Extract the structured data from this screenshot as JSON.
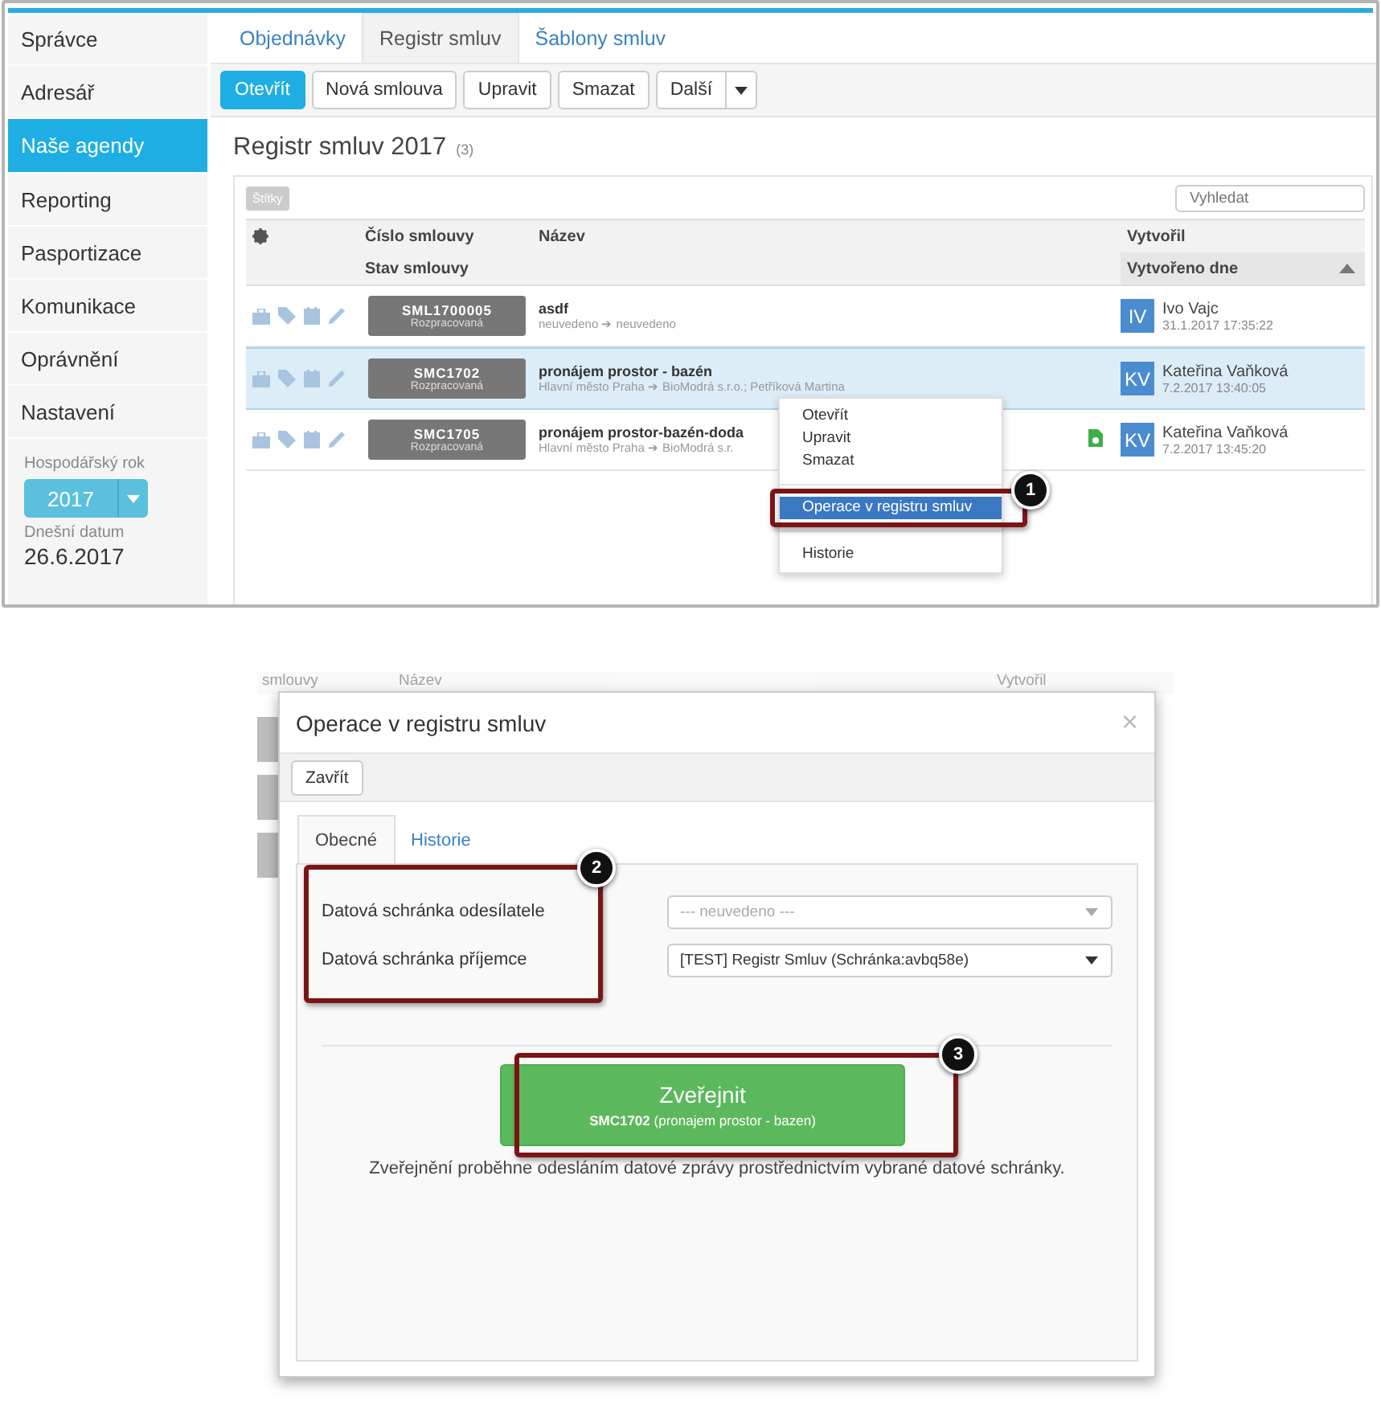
{
  "sidebar": {
    "items": [
      {
        "label": "Správce",
        "selected": false
      },
      {
        "label": "Adresář",
        "selected": false
      },
      {
        "label": "Naše agendy",
        "selected": true
      },
      {
        "label": "Reporting",
        "selected": false
      },
      {
        "label": "Pasportizace",
        "selected": false
      },
      {
        "label": "Komunikace",
        "selected": false
      },
      {
        "label": "Oprávnění",
        "selected": false
      },
      {
        "label": "Nastavení",
        "selected": false
      }
    ],
    "fiscal_year": {
      "label": "Hospodářský rok",
      "value": "2017"
    },
    "today": {
      "label": "Dnešní datum",
      "value": "26.6.2017"
    }
  },
  "tabs": [
    {
      "label": "Objednávky",
      "selected": false
    },
    {
      "label": "Registr smluv",
      "selected": true
    },
    {
      "label": "Šablony smluv",
      "selected": false
    }
  ],
  "toolbar": {
    "buttons": [
      {
        "label": "Otevřít",
        "primary": true
      },
      {
        "label": "Nová smlouva",
        "primary": false
      },
      {
        "label": "Upravit",
        "primary": false
      },
      {
        "label": "Smazat",
        "primary": false
      },
      {
        "label": "Další",
        "primary": false
      }
    ]
  },
  "heading": {
    "title": "Registr smluv 2017",
    "count": "(3)"
  },
  "table": {
    "tags_label": "Štítky",
    "search": {
      "placeholder": "Vyhledat"
    },
    "columns": {
      "number": "Číslo smlouvy",
      "status": "Stav smlouvy",
      "name": "Název",
      "author": "Vytvořil",
      "created": "Vytvořeno dne"
    },
    "rows": [
      {
        "number": "SML1700005",
        "status": "Rozpracovaná",
        "name": "asdf",
        "parties": "neuvedeno ➔ neuvedeno",
        "initials": "IV",
        "author": "Ivo Vajc",
        "created": "31.1.2017 17:35:22",
        "selected": false,
        "attachment": false
      },
      {
        "number": "SMC1702",
        "status": "Rozpracovaná",
        "name": "pronájem prostor - bazén",
        "parties": "Hlavní město Praha ➔ BioModrá s.r.o.; Petříková Martina",
        "initials": "KV",
        "author": "Kateřina Vaňková",
        "created": "7.2.2017 13:40:05",
        "selected": true,
        "attachment": false
      },
      {
        "number": "SMC1705",
        "status": "Rozpracovaná",
        "name": "pronájem prostor-bazén-doda",
        "parties": "Hlavní město Praha ➔ BioModrá s.r.",
        "initials": "KV",
        "author": "Kateřina Vaňková",
        "created": "7.2.2017 13:45:20",
        "selected": false,
        "attachment": true
      }
    ]
  },
  "context_menu": {
    "items": [
      {
        "kind": "item",
        "label": "Otevřít",
        "selected": false
      },
      {
        "kind": "item",
        "label": "Upravit",
        "selected": false
      },
      {
        "kind": "item",
        "label": "Smazat",
        "selected": false
      },
      {
        "kind": "divider"
      },
      {
        "kind": "item",
        "label": "Operace v registru smluv",
        "selected": true
      },
      {
        "kind": "divider"
      },
      {
        "kind": "item",
        "label": "Historie",
        "selected": false
      }
    ],
    "callout": "1"
  },
  "dialog": {
    "background_headers": [
      "smlouvy",
      "Název",
      "Vytvořil"
    ],
    "title": "Operace v registru smluv",
    "close": "×",
    "close_button": "Zavřít",
    "tabs": [
      {
        "label": "Obecné",
        "selected": true
      },
      {
        "label": "Historie",
        "selected": false
      }
    ],
    "fields": [
      {
        "label": "Datová schránka odesílatele",
        "placeholder": "--- neuvedeno ---"
      },
      {
        "label": "Datová schránka příjemce",
        "value": "[TEST] Registr Smluv (Schránka:avbq58e)"
      }
    ],
    "fields_callout": "2",
    "publish": {
      "label": "Zveřejnit",
      "detail": "**SMC1702** (pronajem prostor - bazen)",
      "callout": "3"
    },
    "note": "Zveřejnění proběhne odesláním datové zprávy prostřednictvím vybrané datové schránky."
  }
}
